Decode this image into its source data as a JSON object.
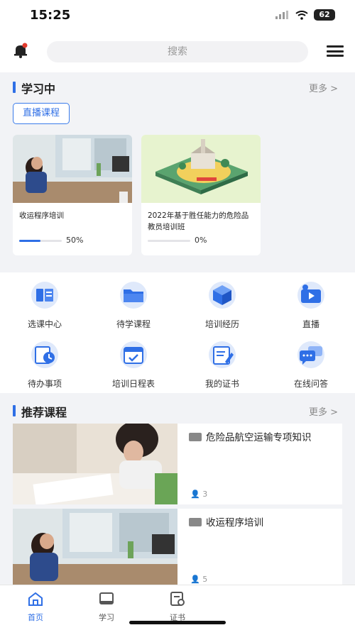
{
  "status_bar": {
    "time": "15:25",
    "battery": "62"
  },
  "header": {
    "search_placeholder": "搜索"
  },
  "learning": {
    "title": "学习中",
    "more": "更多 >",
    "live_tag": "直播课程",
    "courses": [
      {
        "title": "收运程序培训",
        "progress_label": "50%",
        "progress": 0.5
      },
      {
        "title": "2022年基于胜任能力的危险品教员培训班",
        "progress_label": "0%",
        "progress": 0
      }
    ]
  },
  "grid": [
    {
      "label": "选课中心",
      "icon": "book-icon"
    },
    {
      "label": "待学课程",
      "icon": "folder-icon"
    },
    {
      "label": "培训经历",
      "icon": "cube-icon"
    },
    {
      "label": "直播",
      "icon": "live-video-icon"
    },
    {
      "label": "待办事项",
      "icon": "clock-doc-icon"
    },
    {
      "label": "培训日程表",
      "icon": "calendar-icon"
    },
    {
      "label": "我的证书",
      "icon": "certificate-icon"
    },
    {
      "label": "在线问答",
      "icon": "chat-icon"
    }
  ],
  "recommended": {
    "title": "推荐课程",
    "more": "更多 >",
    "items": [
      {
        "title": "危险品航空运输专项知识",
        "count": "3"
      },
      {
        "title": "收运程序培训",
        "count": "5"
      }
    ]
  },
  "nav": [
    {
      "label": "首页",
      "icon": "home-icon",
      "active": true
    },
    {
      "label": "学习",
      "icon": "study-icon",
      "active": false
    },
    {
      "label": "证书",
      "icon": "certificate-nav-icon",
      "active": false
    }
  ],
  "colors": {
    "accent": "#2f6fe6",
    "icon_bg": "#dfe9fb"
  }
}
